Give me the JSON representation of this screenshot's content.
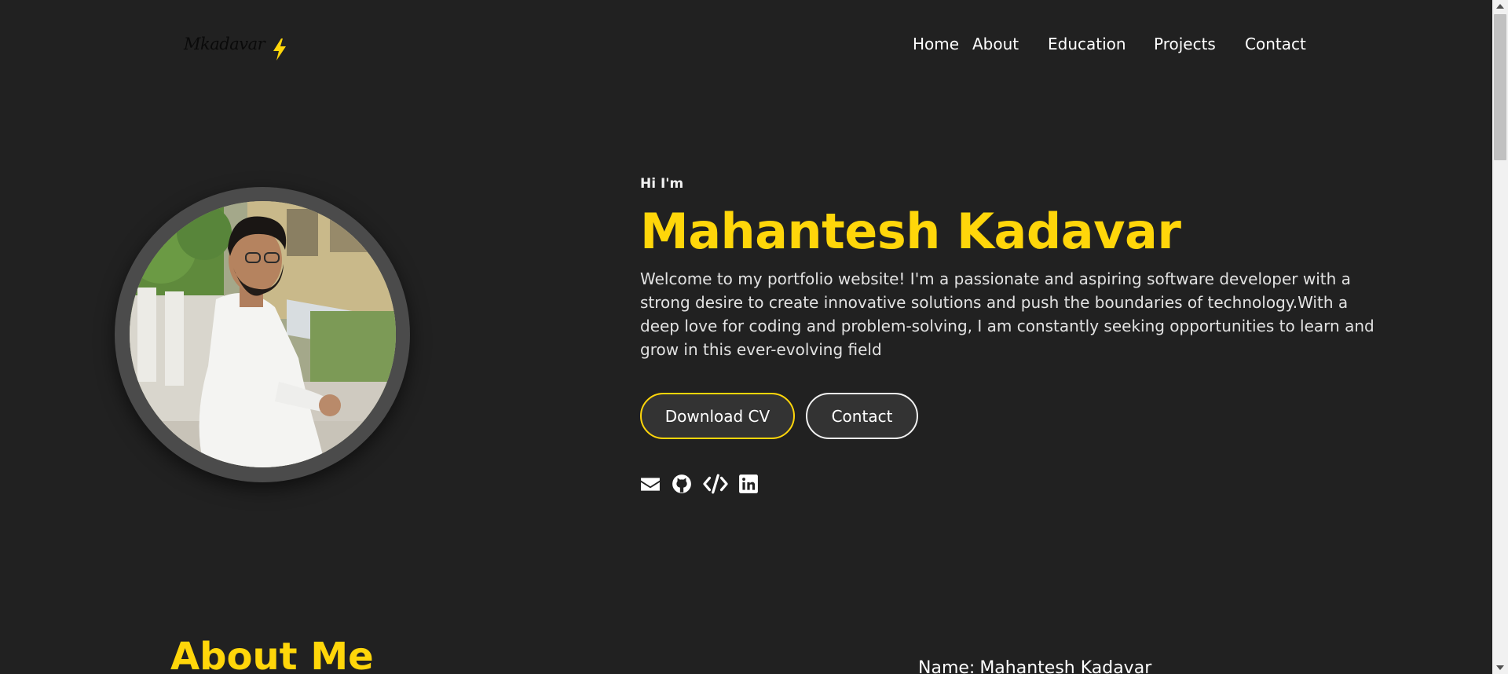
{
  "header": {
    "logo_text": "Mkadavar",
    "logo_icon": "lightning-bolt-icon",
    "nav": [
      {
        "label": "Home"
      },
      {
        "label": "About"
      },
      {
        "label": "Education"
      },
      {
        "label": "Projects"
      },
      {
        "label": "Contact"
      }
    ]
  },
  "hero": {
    "greeting": "Hi I'm",
    "name": "Mahantesh Kadavar",
    "description": "Welcome to my portfolio website! I'm a passionate and aspiring software developer with a strong desire to create innovative solutions and push the boundaries of technology.With a deep love for coding and problem-solving, I am constantly seeking opportunities to learn and grow in this ever-evolving field",
    "buttons": {
      "download_cv": "Download CV",
      "contact": "Contact"
    },
    "socials": [
      {
        "icon": "email-icon"
      },
      {
        "icon": "github-icon"
      },
      {
        "icon": "code-icon"
      },
      {
        "icon": "linkedin-icon"
      }
    ]
  },
  "about": {
    "title": "About Me",
    "name_label": "Name:",
    "name_value": "Mahantesh Kadavar"
  },
  "colors": {
    "background": "#212121",
    "accent": "#ffd60a",
    "text": "#ffffff"
  }
}
